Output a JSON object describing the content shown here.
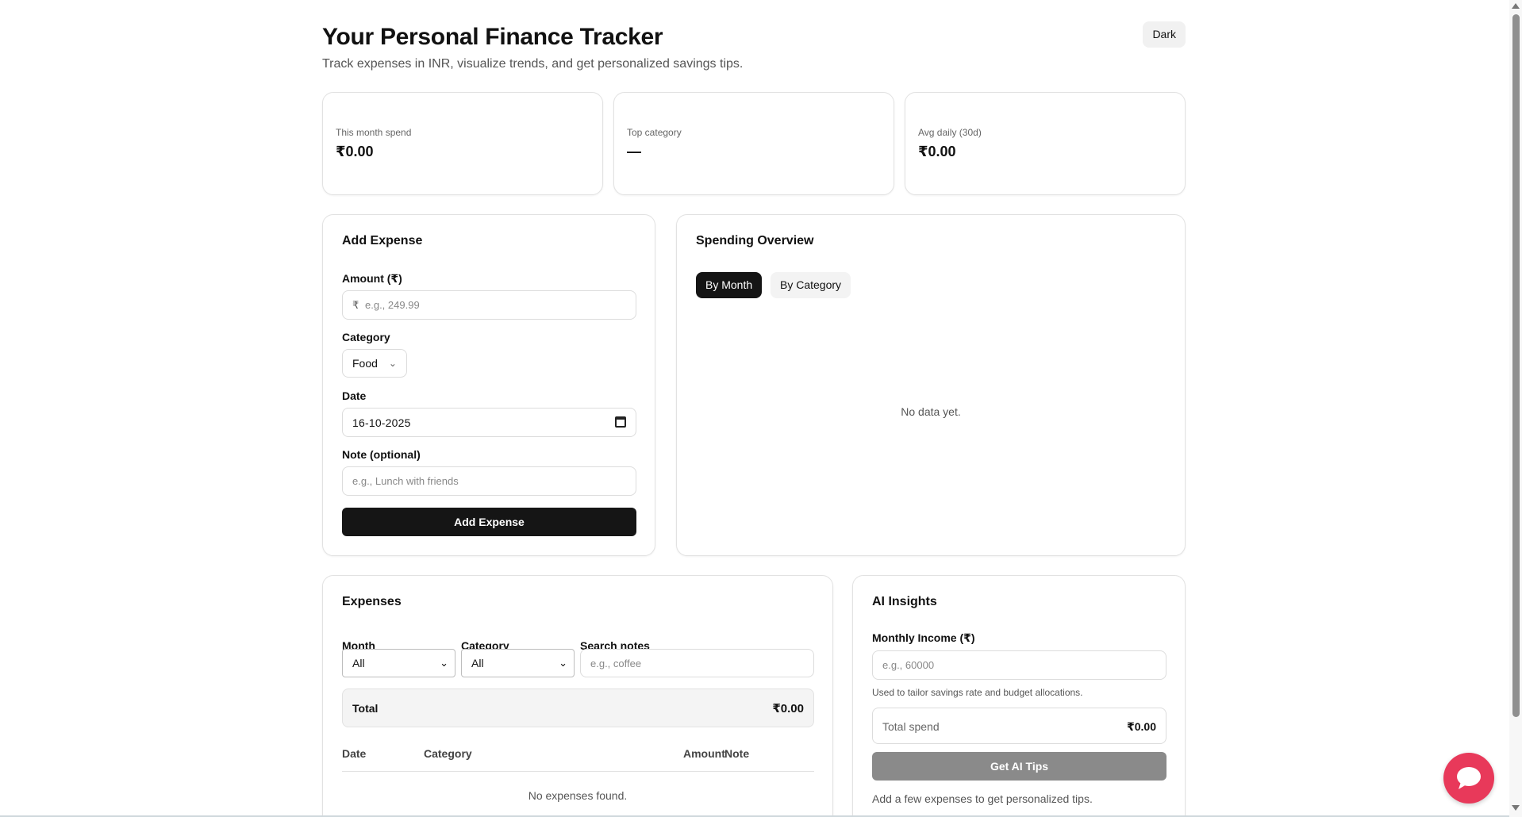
{
  "header": {
    "title": "Your Personal Finance Tracker",
    "subtitle": "Track expenses in INR, visualize trends, and get personalized savings tips.",
    "theme_toggle": "Dark"
  },
  "stats": [
    {
      "label": "This month spend",
      "value": "₹0.00"
    },
    {
      "label": "Top category",
      "value": "—"
    },
    {
      "label": "Avg daily (30d)",
      "value": "₹0.00"
    }
  ],
  "add_expense": {
    "title": "Add Expense",
    "amount_label": "Amount (₹)",
    "amount_prefix": "₹",
    "amount_placeholder": "e.g., 249.99",
    "category_label": "Category",
    "category_value": "Food",
    "date_label": "Date",
    "date_value": "16-10-2025",
    "note_label": "Note (optional)",
    "note_placeholder": "e.g., Lunch with friends",
    "submit_label": "Add Expense"
  },
  "overview": {
    "title": "Spending Overview",
    "tabs": [
      {
        "label": "By Month",
        "active": true
      },
      {
        "label": "By Category",
        "active": false
      }
    ],
    "empty_text": "No data yet."
  },
  "expenses": {
    "title": "Expenses",
    "month_label": "Month",
    "month_value": "All",
    "category_label": "Category",
    "category_value": "All",
    "search_label": "Search notes",
    "search_placeholder": "e.g., coffee",
    "total_label": "Total",
    "total_value": "₹0.00",
    "columns": [
      "Date",
      "Category",
      "Amount",
      "Note"
    ],
    "empty_text": "No expenses found."
  },
  "ai_insights": {
    "title": "AI Insights",
    "income_label": "Monthly Income (₹)",
    "income_placeholder": "e.g., 60000",
    "income_help": "Used to tailor savings rate and budget allocations.",
    "total_spend_label": "Total spend",
    "total_spend_value": "₹0.00",
    "tips_button": "Get AI Tips",
    "empty_text": "Add a few expenses to get personalized tips."
  },
  "colors": {
    "primary_button": "#151515",
    "chat_fab": "#e8395a",
    "disabled_button": "#8a8a8a"
  },
  "icons": {
    "chat": "chat-bubble-icon",
    "calendar": "calendar-icon",
    "dropdown": "chevron-down-icon"
  }
}
